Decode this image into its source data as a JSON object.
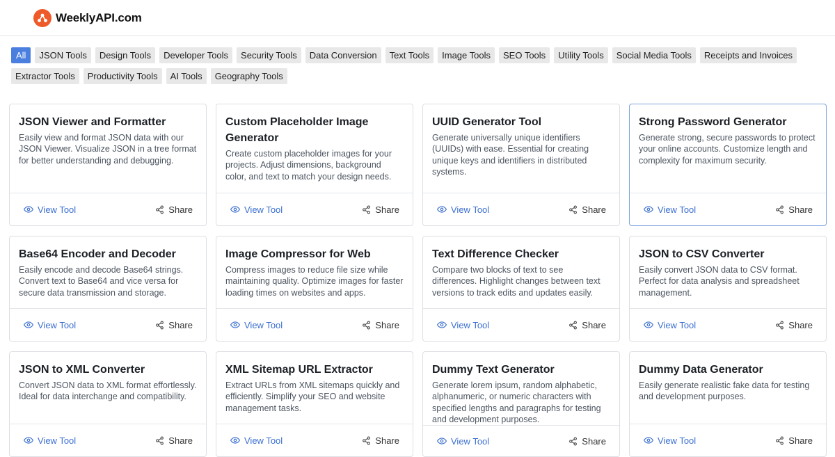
{
  "header": {
    "brand": "WeeklyAPI.com",
    "brand_color": "#ef5a2a"
  },
  "filters": [
    "All",
    "JSON Tools",
    "Design Tools",
    "Developer Tools",
    "Security Tools",
    "Data Conversion",
    "Text Tools",
    "Image Tools",
    "SEO Tools",
    "Utility Tools",
    "Social Media Tools",
    "Receipts and Invoices",
    "Extractor Tools",
    "Productivity Tools",
    "AI Tools",
    "Geography Tools"
  ],
  "active_filter": "All",
  "card_actions": {
    "view_label": "View Tool",
    "share_label": "Share"
  },
  "tools": [
    {
      "title": "JSON Viewer and Formatter",
      "desc": "Easily view and format JSON data with our JSON Viewer. Visualize JSON in a tree format for better understanding and debugging."
    },
    {
      "title": "Custom Placeholder Image Generator",
      "desc": "Create custom placeholder images for your projects. Adjust dimensions, background color, and text to match your design needs."
    },
    {
      "title": "UUID Generator Tool",
      "desc": "Generate universally unique identifiers (UUIDs) with ease. Essential for creating unique keys and identifiers in distributed systems."
    },
    {
      "title": "Strong Password Generator",
      "desc": "Generate strong, secure passwords to protect your online accounts. Customize length and complexity for maximum security."
    },
    {
      "title": "Base64 Encoder and Decoder",
      "desc": "Easily encode and decode Base64 strings. Convert text to Base64 and vice versa for secure data transmission and storage."
    },
    {
      "title": "Image Compressor for Web",
      "desc": "Compress images to reduce file size while maintaining quality. Optimize images for faster loading times on websites and apps."
    },
    {
      "title": "Text Difference Checker",
      "desc": "Compare two blocks of text to see differences. Highlight changes between text versions to track edits and updates easily."
    },
    {
      "title": "JSON to CSV Converter",
      "desc": "Easily convert JSON data to CSV format. Perfect for data analysis and spreadsheet management."
    },
    {
      "title": "JSON to XML Converter",
      "desc": "Convert JSON data to XML format effortlessly. Ideal for data interchange and compatibility."
    },
    {
      "title": "XML Sitemap URL Extractor",
      "desc": "Extract URLs from XML sitemaps quickly and efficiently. Simplify your SEO and website management tasks."
    },
    {
      "title": "Dummy Text Generator",
      "desc": "Generate lorem ipsum, random alphabetic, alphanumeric, or numeric characters with specified lengths and paragraphs for testing and development purposes."
    },
    {
      "title": "Dummy Data Generator",
      "desc": "Easily generate realistic fake data for testing and development purposes."
    }
  ]
}
